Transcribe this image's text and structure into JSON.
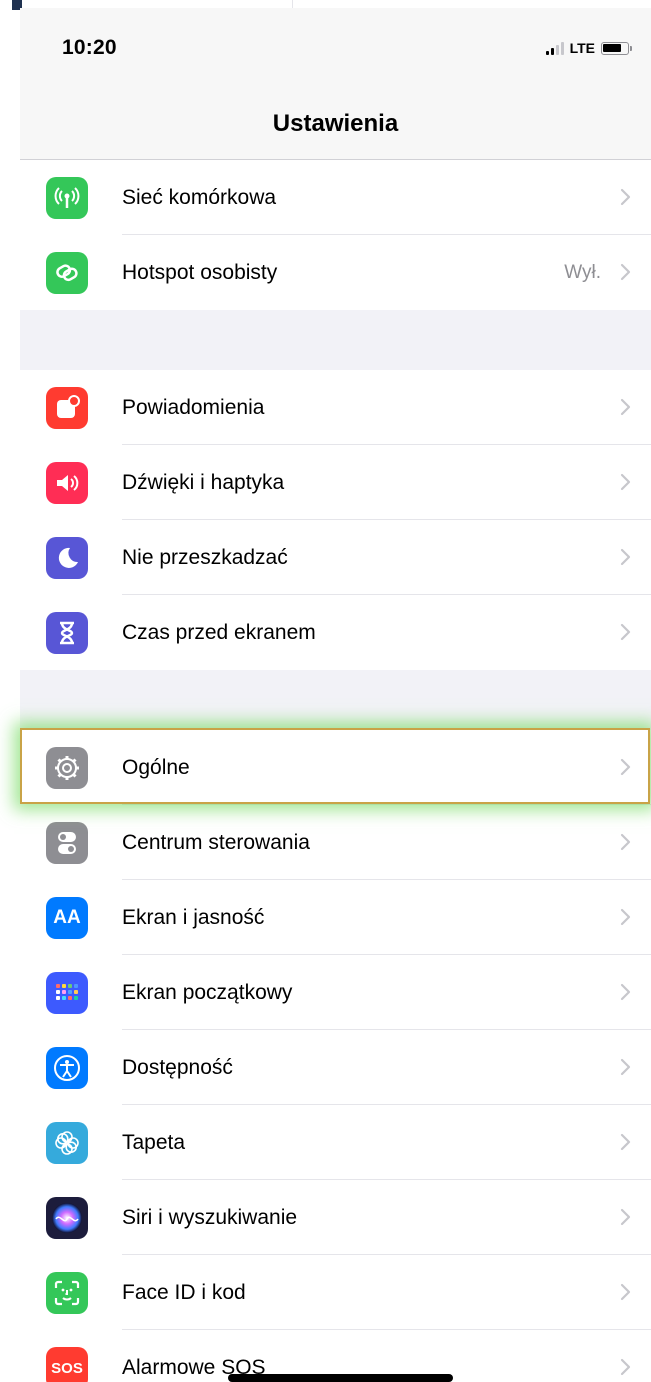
{
  "status_bar": {
    "time": "10:20",
    "network": "LTE"
  },
  "nav": {
    "title": "Ustawienia"
  },
  "groups": [
    {
      "items": [
        {
          "label": "Sieć komórkowa",
          "icon": "antenna-icon",
          "color": "#34c759"
        },
        {
          "label": "Hotspot osobisty",
          "value": "Wył.",
          "icon": "hotspot-chain-icon",
          "color": "#34c759"
        }
      ]
    },
    {
      "items": [
        {
          "label": "Powiadomienia",
          "icon": "notifications-icon",
          "color": "#ff3b30"
        },
        {
          "label": "Dźwięki i haptyka",
          "icon": "speaker-icon",
          "color": "#ff2d55"
        },
        {
          "label": "Nie przeszkadzać",
          "icon": "moon-icon",
          "color": "#5856d6"
        },
        {
          "label": "Czas przed ekranem",
          "icon": "hourglass-icon",
          "color": "#5856d6"
        }
      ]
    },
    {
      "items": [
        {
          "label": "Ogólne",
          "icon": "gear-icon",
          "color": "#8e8e93",
          "highlighted": true
        },
        {
          "label": "Centrum sterowania",
          "icon": "toggles-icon",
          "color": "#8e8e93"
        },
        {
          "label": "Ekran i jasność",
          "icon": "text-size-icon",
          "color": "#007aff",
          "icon_text": "AA"
        },
        {
          "label": "Ekran początkowy",
          "icon": "app-grid-icon",
          "color": "#3d5afe"
        },
        {
          "label": "Dostępność",
          "icon": "accessibility-icon",
          "color": "#007aff"
        },
        {
          "label": "Tapeta",
          "icon": "flower-icon",
          "color": "#35aadc"
        },
        {
          "label": "Siri i wyszukiwanie",
          "icon": "siri-icon",
          "color": "#1c1c3c"
        },
        {
          "label": "Face ID i kod",
          "icon": "face-id-icon",
          "color": "#34c759"
        },
        {
          "label": "Alarmowe SOS",
          "icon": "sos-icon",
          "color": "#ff3b30",
          "icon_text": "SOS"
        }
      ]
    }
  ],
  "colors": {
    "highlight_border": "#c9a347",
    "highlight_glow": "#78dc64",
    "chevron": "#c7c7cc"
  }
}
